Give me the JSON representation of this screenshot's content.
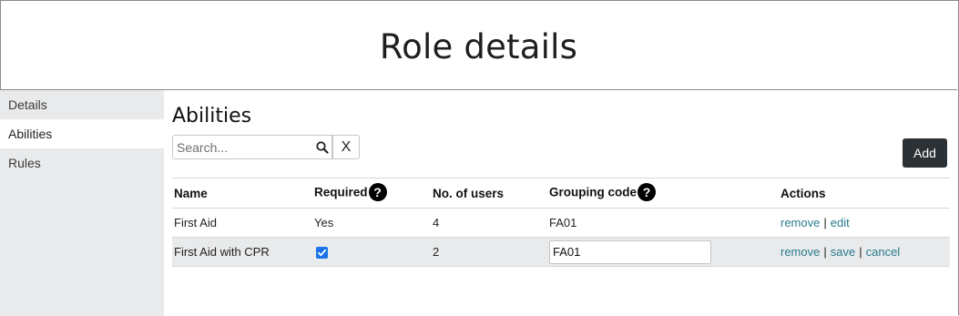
{
  "header": {
    "title": "Role details"
  },
  "sidebar": {
    "items": [
      {
        "label": "Details"
      },
      {
        "label": "Abilities"
      },
      {
        "label": "Rules"
      }
    ]
  },
  "main": {
    "section_title": "Abilities",
    "search": {
      "placeholder": "Search...",
      "clear_label": "X"
    },
    "add_label": "Add",
    "table": {
      "headers": {
        "name": "Name",
        "required": "Required",
        "users": "No. of users",
        "grouping": "Grouping code",
        "actions": "Actions"
      },
      "help_glyph": "?",
      "rows": [
        {
          "name": "First Aid",
          "required": "Yes",
          "users": "4",
          "grouping": "FA01",
          "actions": {
            "remove": "remove",
            "edit": "edit"
          }
        },
        {
          "name": "First Aid with CPR",
          "required_checked": true,
          "users": "2",
          "grouping": "FA01",
          "actions": {
            "remove": "remove",
            "save": "save",
            "cancel": "cancel"
          }
        }
      ],
      "separator": "|"
    }
  },
  "colors": {
    "link": "#2a7b8e",
    "sidebar_bg": "#e8eaeb",
    "button_dark": "#2c3135",
    "checkbox": "#1a73e8"
  },
  "icons": [
    "search-icon",
    "help-icon",
    "checkbox-checked-icon"
  ]
}
